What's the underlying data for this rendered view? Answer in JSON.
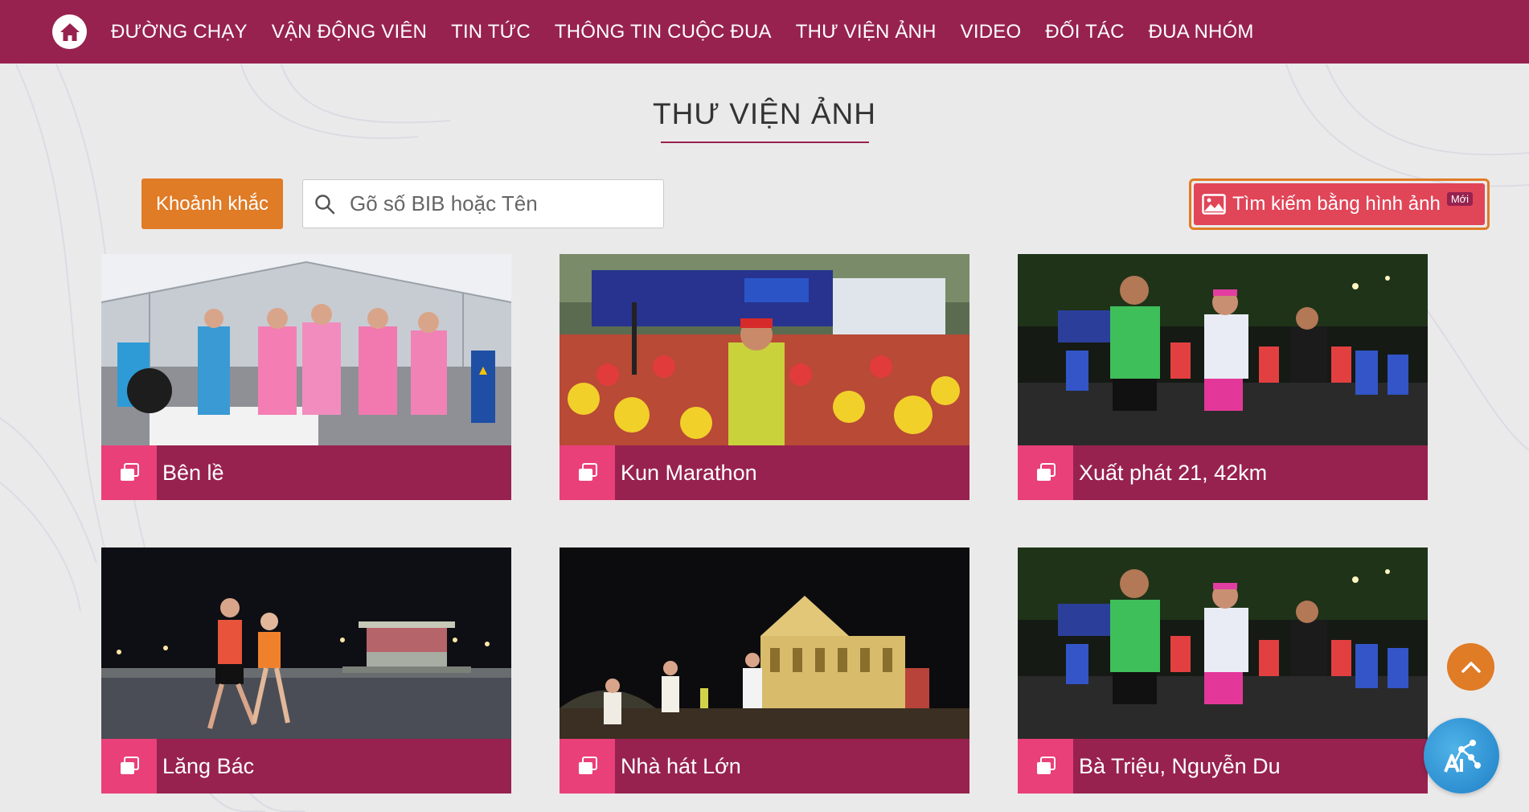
{
  "nav": {
    "items": [
      {
        "label": "ĐƯỜNG CHẠY"
      },
      {
        "label": "VẬN ĐỘNG VIÊN"
      },
      {
        "label": "TIN TỨC"
      },
      {
        "label": "THÔNG TIN CUỘC ĐUA"
      },
      {
        "label": "THƯ VIỆN ẢNH"
      },
      {
        "label": "VIDEO"
      },
      {
        "label": "ĐỐI TÁC"
      },
      {
        "label": "ĐUA NHÓM"
      }
    ],
    "home_icon": "home-icon"
  },
  "page": {
    "title": "THƯ VIỆN ẢNH"
  },
  "controls": {
    "moment_label": "Khoảnh khắc",
    "search_placeholder": "Gõ số BIB hoặc Tên",
    "search_value": "",
    "image_search_label": "Tìm kiếm bằng hình ảnh",
    "new_badge": "Mới"
  },
  "albums": [
    {
      "title": "Bên lề",
      "icon": "gallery-icon"
    },
    {
      "title": "Kun Marathon",
      "icon": "gallery-icon"
    },
    {
      "title": "Xuất phát 21, 42km",
      "icon": "gallery-icon"
    },
    {
      "title": "Lăng Bác",
      "icon": "gallery-icon"
    },
    {
      "title": "Nhà hát Lớn",
      "icon": "gallery-icon"
    },
    {
      "title": "Bà Triệu, Nguyễn Du",
      "icon": "gallery-icon"
    }
  ],
  "colors": {
    "brand": "#97224f",
    "accent": "#e07b26",
    "pink": "#e9407a",
    "image_search": "#e04558",
    "background": "#ebeaea"
  },
  "floating": {
    "scroll_top_icon": "chevron-up-icon",
    "ai_icon": "ai-assistant-icon"
  }
}
